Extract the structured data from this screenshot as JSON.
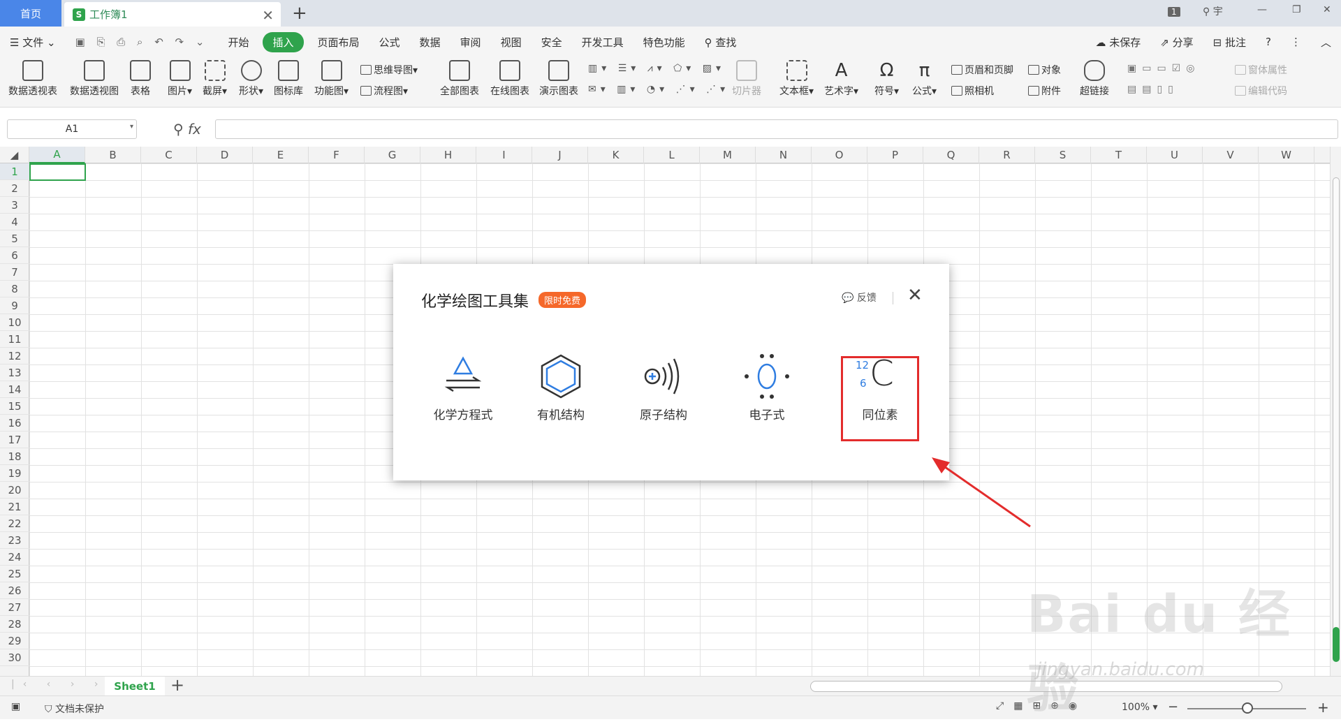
{
  "titlebar": {
    "home_tab": "首页",
    "doc_tab": "工作簿1",
    "doc_icon_letter": "S",
    "add_tab": "+",
    "badge_count": "1",
    "user_name": "宇"
  },
  "menu": {
    "file": "文件",
    "items": [
      "开始",
      "插入",
      "页面布局",
      "公式",
      "数据",
      "审阅",
      "视图",
      "安全",
      "开发工具",
      "特色功能"
    ],
    "active": "插入",
    "search": "查找",
    "unsaved": "未保存",
    "share": "分享",
    "comment": "批注"
  },
  "ribbon": {
    "pivot_table": "数据透视表",
    "pivot_chart": "数据透视图",
    "table": "表格",
    "picture": "图片",
    "screenshot": "截屏",
    "shape": "形状",
    "icon_lib": "图标库",
    "func_chart": "功能图",
    "mindmap": "思维导图",
    "flowchart": "流程图",
    "all_charts": "全部图表",
    "online_charts": "在线图表",
    "demo_charts": "演示图表",
    "slicer": "切片器",
    "textbox": "文本框",
    "wordart": "艺术字",
    "symbol": "符号",
    "formula": "公式",
    "header_footer": "页眉和页脚",
    "object": "对象",
    "camera": "照相机",
    "attachment": "附件",
    "hyperlink": "超链接",
    "window_props": "窗体属性",
    "edit_code": "编辑代码"
  },
  "formula_bar": {
    "cell_ref": "A1",
    "fx": "fx",
    "value": ""
  },
  "grid": {
    "columns": [
      "A",
      "B",
      "C",
      "D",
      "E",
      "F",
      "G",
      "H",
      "I",
      "J",
      "K",
      "L",
      "M",
      "N",
      "O",
      "P",
      "Q",
      "R",
      "S",
      "T",
      "U",
      "V",
      "W"
    ],
    "rows": [
      "1",
      "2",
      "3",
      "4",
      "5",
      "6",
      "7",
      "8",
      "9",
      "10",
      "11",
      "12",
      "13",
      "14",
      "15",
      "16",
      "17",
      "18",
      "19",
      "20",
      "21",
      "22",
      "23",
      "24",
      "25",
      "26",
      "27",
      "28",
      "29",
      "30"
    ]
  },
  "sheets": {
    "tab": "Sheet1",
    "add": "+"
  },
  "status": {
    "protection": "文档未保护",
    "zoom": "100%"
  },
  "dialog": {
    "title": "化学绘图工具集",
    "badge": "限时免费",
    "feedback": "反馈",
    "tools": [
      {
        "label": "化学方程式"
      },
      {
        "label": "有机结构"
      },
      {
        "label": "原子结构"
      },
      {
        "label": "电子式"
      },
      {
        "label": "同位素",
        "mass_number": "12",
        "atomic_number": "6",
        "symbol": "C"
      }
    ],
    "highlight_color": "#e32c2c"
  },
  "colors": {
    "accent": "#2fa34c",
    "home_tab": "#4a86e8",
    "badge": "#f5682a"
  },
  "watermark": {
    "brand": "Bai du 经验",
    "url": "jingyan.baidu.com"
  }
}
